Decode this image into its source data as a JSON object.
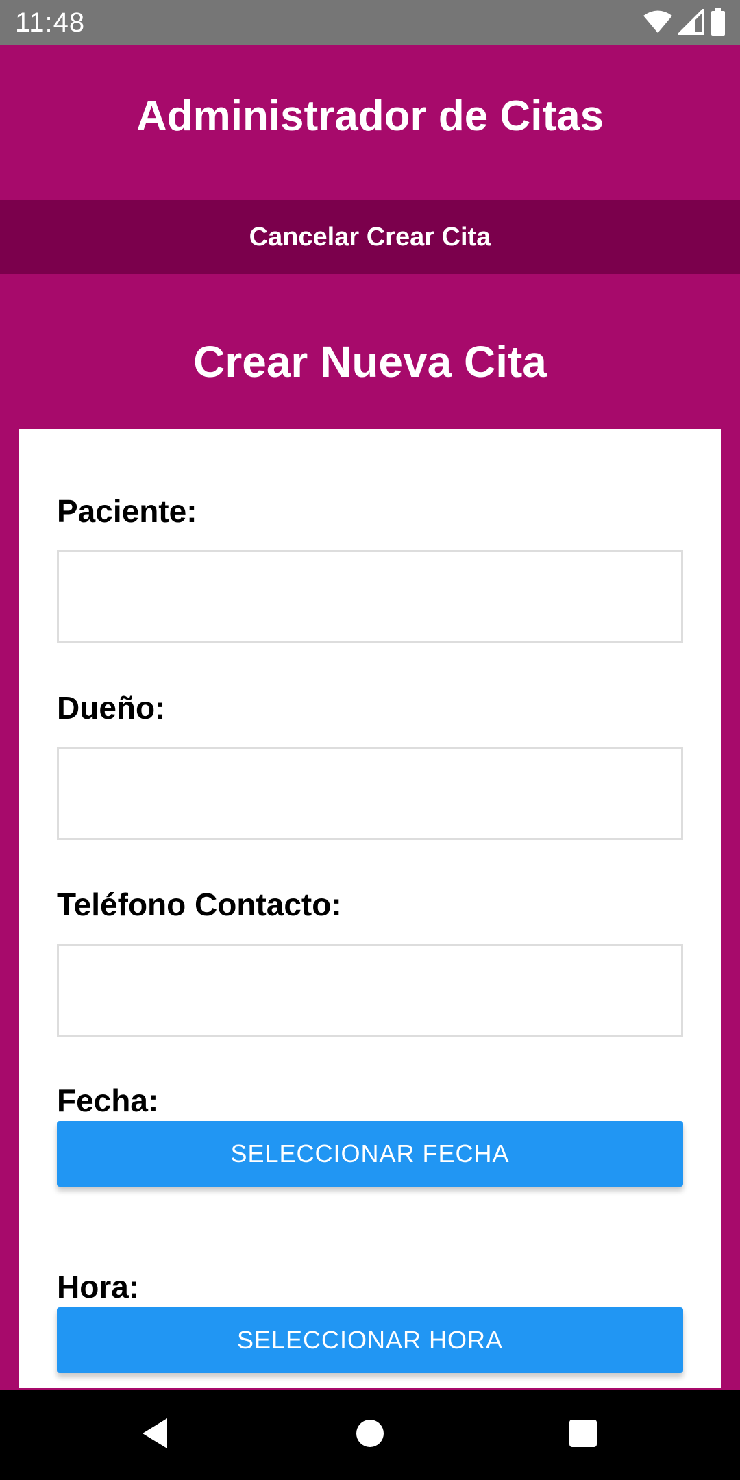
{
  "status_bar": {
    "time": "11:48",
    "icons": [
      "wifi-icon",
      "cell-signal-icon",
      "battery-icon"
    ]
  },
  "header": {
    "title": "Administrador de Citas"
  },
  "cancel_bar": {
    "label": "Cancelar Crear Cita"
  },
  "form": {
    "title": "Crear Nueva Cita",
    "fields": [
      {
        "label": "Paciente:",
        "value": ""
      },
      {
        "label": "Dueño:",
        "value": ""
      },
      {
        "label": "Teléfono Contacto:",
        "value": ""
      }
    ],
    "date": {
      "label": "Fecha:",
      "button": "SELECCIONAR FECHA"
    },
    "time": {
      "label": "Hora:",
      "button": "SELECCIONAR HORA"
    }
  },
  "nav_bar": {
    "icons": [
      "back-icon",
      "home-icon",
      "recents-icon"
    ]
  },
  "colors": {
    "primary": "#a70a6b",
    "primary_dark": "#7b004c",
    "button": "#2196f3",
    "status_bar": "#767676"
  }
}
